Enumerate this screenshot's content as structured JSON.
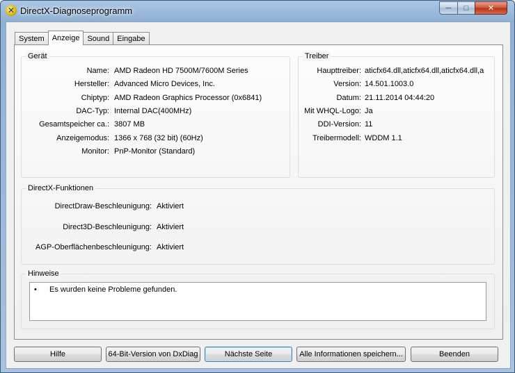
{
  "window": {
    "title": "DirectX-Diagnoseprogramm",
    "min_glyph": "─",
    "max_glyph": "□",
    "close_glyph": "✕"
  },
  "tabs": [
    {
      "label": "System"
    },
    {
      "label": "Anzeige"
    },
    {
      "label": "Sound"
    },
    {
      "label": "Eingabe"
    }
  ],
  "active_tab": "Anzeige",
  "geraet": {
    "legend": "Gerät",
    "rows": [
      {
        "label": "Name:",
        "value": "AMD Radeon HD 7500M/7600M Series"
      },
      {
        "label": "Hersteller:",
        "value": "Advanced Micro Devices, Inc."
      },
      {
        "label": "Chiptyp:",
        "value": "AMD Radeon Graphics Processor (0x6841)"
      },
      {
        "label": "DAC-Typ:",
        "value": "Internal DAC(400MHz)"
      },
      {
        "label": "Gesamtspeicher ca.:",
        "value": "3807 MB"
      },
      {
        "label": "Anzeigemodus:",
        "value": "1366 x 768 (32 bit) (60Hz)"
      },
      {
        "label": "Monitor:",
        "value": "PnP-Monitor (Standard)"
      }
    ]
  },
  "treiber": {
    "legend": "Treiber",
    "rows": [
      {
        "label": "Haupttreiber:",
        "value": "aticfx64.dll,aticfx64.dll,aticfx64.dll,a"
      },
      {
        "label": "Version:",
        "value": "14.501.1003.0"
      },
      {
        "label": "Datum:",
        "value": "21.11.2014 04:44:20"
      },
      {
        "label": "Mit WHQL-Logo:",
        "value": "Ja"
      },
      {
        "label": "DDI-Version:",
        "value": "11"
      },
      {
        "label": "Treibermodell:",
        "value": "WDDM 1.1"
      }
    ]
  },
  "directx": {
    "legend": "DirectX-Funktionen",
    "rows": [
      {
        "label": "DirectDraw-Beschleunigung:",
        "value": "Aktiviert"
      },
      {
        "label": "Direct3D-Beschleunigung:",
        "value": "Aktiviert"
      },
      {
        "label": "AGP-Oberflächenbeschleunigung:",
        "value": "Aktiviert"
      }
    ]
  },
  "hinweise": {
    "legend": "Hinweise",
    "bullet": "•",
    "items": [
      "Es wurden keine Probleme gefunden."
    ]
  },
  "buttons": {
    "help": "Hilfe",
    "dxdiag64": "64-Bit-Version von DxDiag",
    "next": "Nächste Seite",
    "save": "Alle Informationen speichern...",
    "exit": "Beenden"
  },
  "colors": {
    "titlebar": "#a9c6e3",
    "close_button": "#c8432a",
    "default_button_border": "#3c7fb1"
  }
}
